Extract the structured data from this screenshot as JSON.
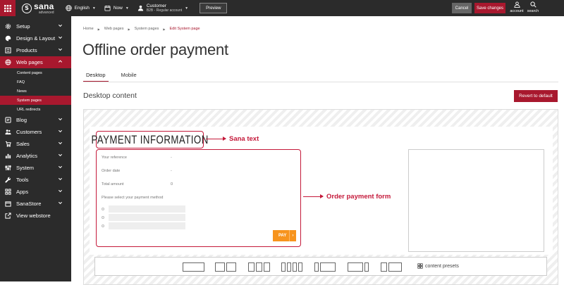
{
  "topbar": {
    "logo": {
      "name": "sana",
      "tagline": "advanced"
    },
    "language": "English",
    "date": "Now",
    "customer": {
      "label": "Customer",
      "account": "B2B - Regular account"
    },
    "preview": "Preview",
    "cancel": "Cancel",
    "save": "Save changes",
    "account": "account",
    "search": "search"
  },
  "sidebar": {
    "items": [
      {
        "label": "Setup",
        "icon": "gear-icon"
      },
      {
        "label": "Design & Layout",
        "icon": "palette-icon"
      },
      {
        "label": "Products",
        "icon": "products-icon"
      },
      {
        "label": "Web pages",
        "icon": "globe-icon",
        "active": true
      },
      {
        "label": "Blog",
        "icon": "blog-icon"
      },
      {
        "label": "Customers",
        "icon": "customers-icon"
      },
      {
        "label": "Sales",
        "icon": "sales-icon"
      },
      {
        "label": "Analytics",
        "icon": "analytics-icon"
      },
      {
        "label": "System",
        "icon": "system-icon"
      },
      {
        "label": "Tools",
        "icon": "wrench-icon"
      },
      {
        "label": "Apps",
        "icon": "apps-icon"
      },
      {
        "label": "SanaStore",
        "icon": "store-icon"
      },
      {
        "label": "View webstore",
        "icon": "external-link-icon"
      }
    ],
    "subitems": [
      {
        "label": "Content pages"
      },
      {
        "label": "FAQ"
      },
      {
        "label": "News"
      },
      {
        "label": "System pages",
        "active": true
      },
      {
        "label": "URL redirects"
      }
    ]
  },
  "breadcrumb": [
    "Home",
    "Web pages",
    "System pages",
    "Edit System page"
  ],
  "page_title": "Offline order payment",
  "tabs": [
    "Desktop",
    "Mobile"
  ],
  "section_title": "Desktop content",
  "revert": "Revert to default",
  "content": {
    "heading": "PAYMENT INFORMATION",
    "annotation_text": "Sana text",
    "annotation_form": "Order payment form",
    "fields": [
      {
        "label": "Your reference",
        "value": "-"
      },
      {
        "label": "Order date",
        "value": "-"
      },
      {
        "label": "Total amount",
        "value": "0"
      }
    ],
    "select_method": "Please select your payment method",
    "pay": "PAY",
    "pay_arrow": "›",
    "presets_label": "content presets"
  },
  "colors": {
    "brand": "#a8182e",
    "annotation": "#c4193a",
    "pay_button": "#f7941d",
    "sidebar": "#2b2b2b"
  }
}
